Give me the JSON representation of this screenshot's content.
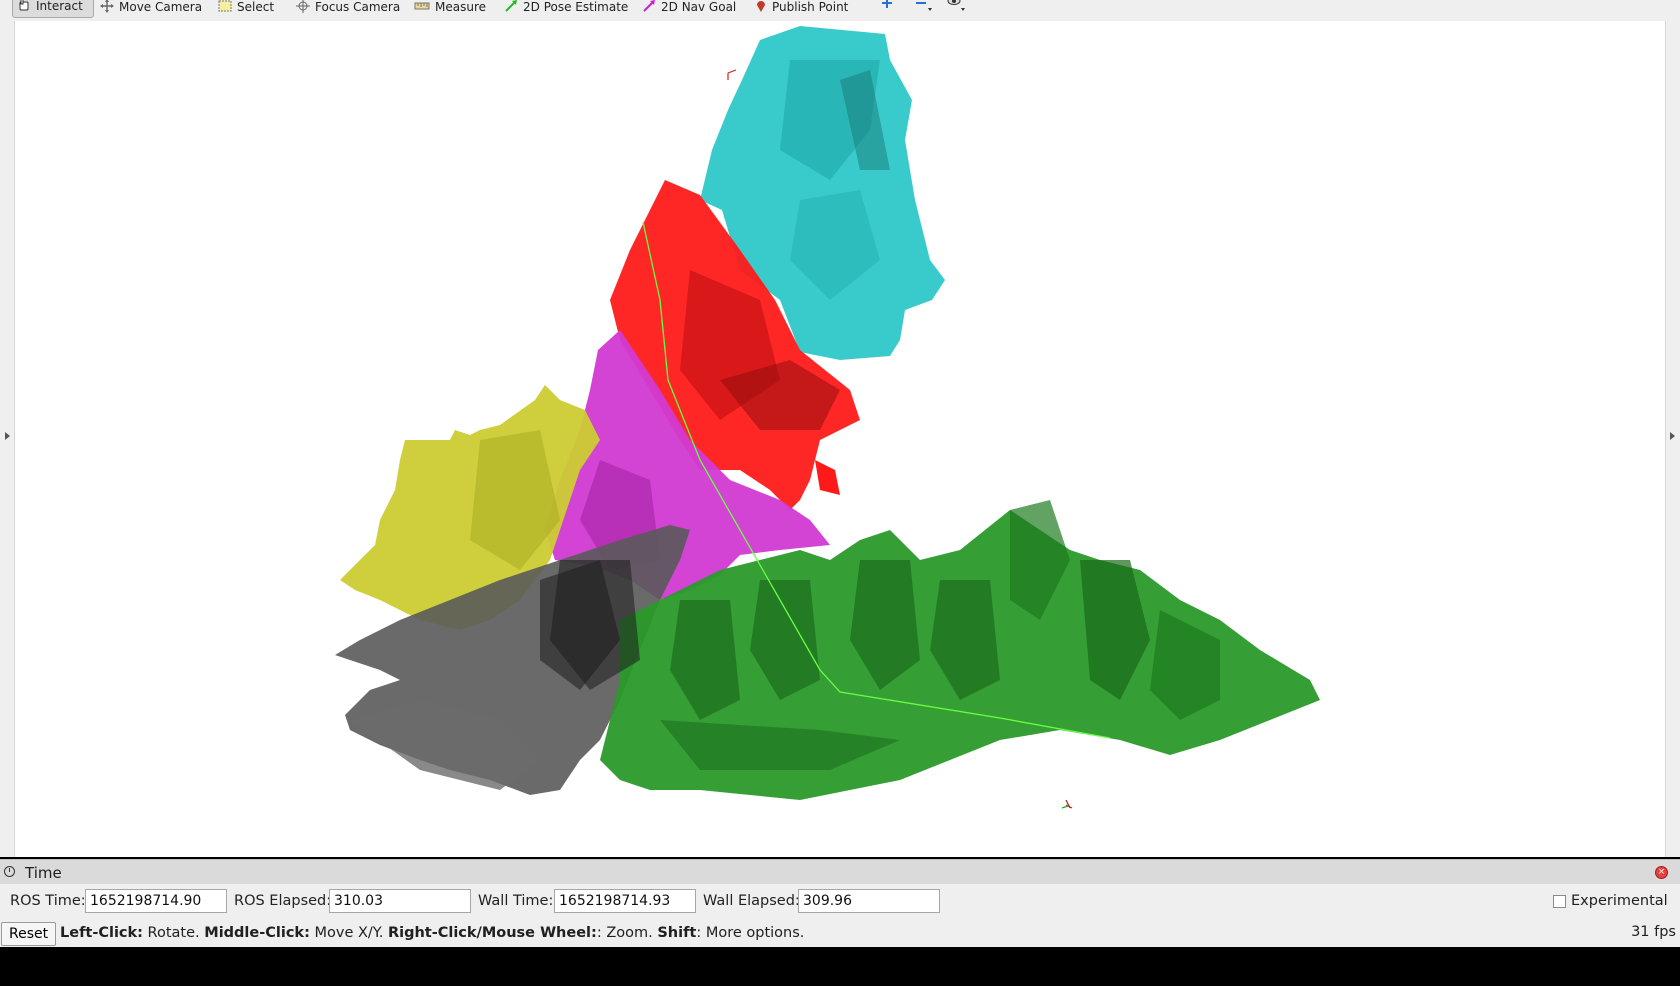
{
  "toolbar": {
    "tools": [
      {
        "label": "Interact",
        "icon": "hand-cursor-icon",
        "active": true
      },
      {
        "label": "Move Camera",
        "icon": "move-arrows-icon"
      },
      {
        "label": "Select",
        "icon": "select-box-icon"
      },
      {
        "label": "Focus Camera",
        "icon": "focus-crosshair-icon"
      },
      {
        "label": "Measure",
        "icon": "ruler-icon"
      },
      {
        "label": "2D Pose Estimate",
        "icon": "green-arrow-icon"
      },
      {
        "label": "2D Nav Goal",
        "icon": "magenta-arrow-icon"
      },
      {
        "label": "Publish Point",
        "icon": "map-pin-icon"
      }
    ],
    "extra_icons": [
      "plus-icon",
      "minus-icon",
      "eye-icon"
    ]
  },
  "colors": {
    "cyan_region": "#2ec8c8",
    "red_region": "#ff1a1a",
    "magenta_region": "#d23ad2",
    "yellow_region": "#cccc33",
    "gray_region": "#5a5a5a",
    "green_region": "#2a9a2a",
    "path_line": "#66ff44"
  },
  "time_panel": {
    "title": "Time",
    "ros_time_label": "ROS Time:",
    "ros_time_value": "1652198714.90",
    "ros_elapsed_label": "ROS Elapsed:",
    "ros_elapsed_value": "310.03",
    "wall_time_label": "Wall Time:",
    "wall_time_value": "1652198714.93",
    "wall_elapsed_label": "Wall Elapsed:",
    "wall_elapsed_value": "309.96",
    "experimental_label": "Experimental"
  },
  "status": {
    "reset_label": "Reset",
    "help_left_click": "Left-Click:",
    "help_rotate": " Rotate. ",
    "help_middle_click": "Middle-Click:",
    "help_move": " Move X/Y. ",
    "help_right_click": "Right-Click/Mouse Wheel:",
    "help_zoom": ": Zoom. ",
    "help_shift": "Shift",
    "help_more": ": More options.",
    "fps": "31 fps"
  }
}
